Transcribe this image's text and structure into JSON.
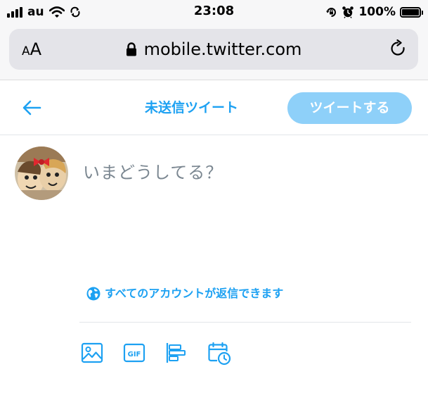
{
  "status_bar": {
    "carrier": "au",
    "time": "23:08",
    "battery_percent": "100%"
  },
  "browser": {
    "text_size_button": {
      "small": "A",
      "large": "A"
    },
    "url": "mobile.twitter.com"
  },
  "compose": {
    "header_title": "未送信ツイート",
    "tweet_button_label": "ツイートする",
    "placeholder": "いまどうしてる？",
    "reply_setting_label": "すべてのアカウントが返信できます",
    "toolbar": {
      "gif_label": "GIF",
      "items": [
        "image-icon",
        "gif-icon",
        "poll-icon",
        "schedule-icon"
      ]
    }
  },
  "colors": {
    "accent": "#1da1f2",
    "tweet_button_disabled": "#8ed0f9",
    "placeholder_text": "#7b8791",
    "browser_chrome": "#f7f7f8",
    "url_field": "#e4e4e9"
  }
}
